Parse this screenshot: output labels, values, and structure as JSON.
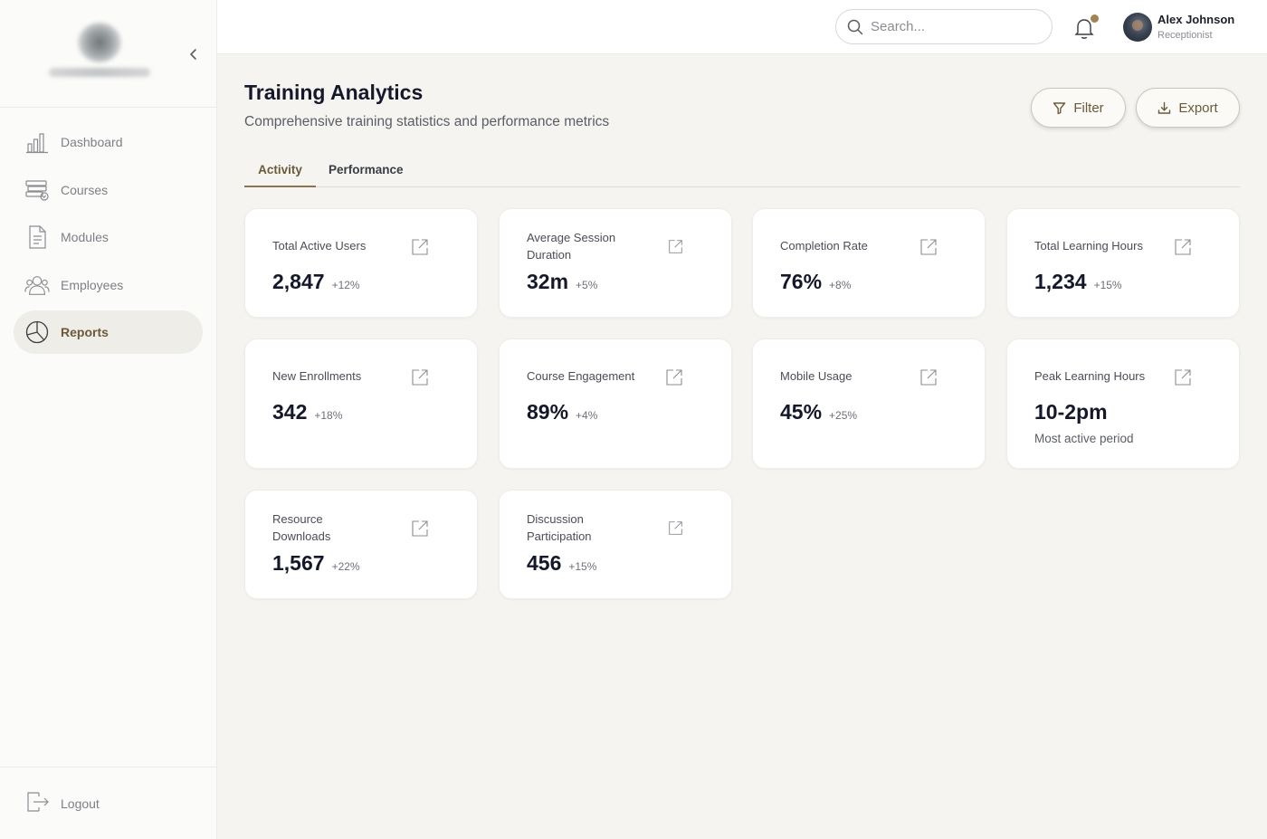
{
  "header": {
    "search_placeholder": "Search...",
    "user_name": "Alex Johnson",
    "user_role": "Receptionist"
  },
  "sidebar": {
    "items": [
      {
        "label": "Dashboard",
        "icon": "bar-chart-icon"
      },
      {
        "label": "Courses",
        "icon": "books-icon"
      },
      {
        "label": "Modules",
        "icon": "document-icon"
      },
      {
        "label": "Employees",
        "icon": "users-icon"
      },
      {
        "label": "Reports",
        "icon": "pie-chart-icon",
        "active": true
      }
    ],
    "logout_label": "Logout"
  },
  "page": {
    "title": "Training Analytics",
    "subtitle": "Comprehensive training statistics and performance metrics",
    "filter_label": "Filter",
    "export_label": "Export"
  },
  "tabs": [
    {
      "label": "Activity",
      "active": true
    },
    {
      "label": "Performance",
      "active": false
    }
  ],
  "cards": [
    {
      "label": "Total Active Users",
      "value": "2,847",
      "change": "+12%"
    },
    {
      "label": "Average Session Duration",
      "value": "32m",
      "change": "+5%"
    },
    {
      "label": "Completion Rate",
      "value": "76%",
      "change": "+8%"
    },
    {
      "label": "Total Learning Hours",
      "value": "1,234",
      "change": "+15%"
    },
    {
      "label": "New Enrollments",
      "value": "342",
      "change": "+18%"
    },
    {
      "label": "Course Engagement",
      "value": "89%",
      "change": "+4%"
    },
    {
      "label": "Mobile Usage",
      "value": "45%",
      "change": "+25%"
    },
    {
      "label": "Peak Learning Hours",
      "value": "10-2pm",
      "sub": "Most active period"
    },
    {
      "label": "Resource Downloads",
      "value": "1,567",
      "change": "+22%"
    },
    {
      "label": "Discussion Participation",
      "value": "456",
      "change": "+15%"
    }
  ],
  "colors": {
    "accent": "#6b5a3a",
    "active_nav_bg": "#efede7",
    "page_bg": "#f5f4f0",
    "notification_dot": "#a08453"
  }
}
